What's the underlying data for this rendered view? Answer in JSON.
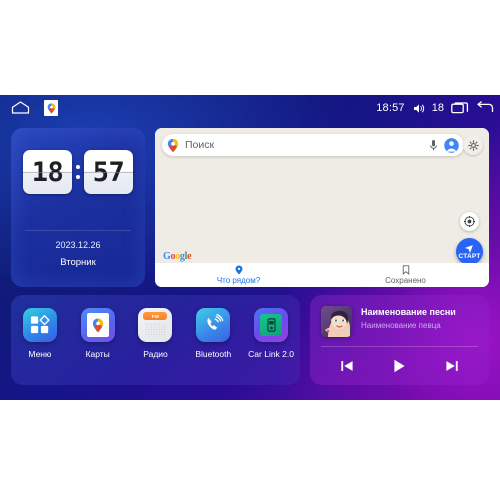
{
  "statusbar": {
    "home_icon": "home-icon",
    "notification_icon": "google-maps-notification-icon",
    "time": "18:57",
    "volume_icon": "volume-icon",
    "volume_level": "18",
    "recents_icon": "recents-icon",
    "back_icon": "back-icon"
  },
  "clock_widget": {
    "hours": "18",
    "minutes": "57",
    "date": "2023.12.26",
    "weekday": "Вторник"
  },
  "maps_widget": {
    "search": {
      "placeholder": "Поиск",
      "pin_icon": "google-maps-pin-icon",
      "mic_icon": "microphone-icon",
      "avatar_icon": "account-avatar-icon"
    },
    "settings_icon": "gear-icon",
    "locate_icon": "compass-locate-icon",
    "start_button": {
      "label": "СТАРТ",
      "icon": "navigation-arrow-icon"
    },
    "watermark": "Google",
    "tabs": [
      {
        "label": "Что рядом?",
        "icon": "map-pin-icon",
        "active": true
      },
      {
        "label": "Сохранено",
        "icon": "bookmark-icon",
        "active": false
      }
    ]
  },
  "apps": [
    {
      "label": "Меню",
      "icon": "menu-grid-icon"
    },
    {
      "label": "Карты",
      "icon": "google-maps-icon"
    },
    {
      "label": "Радио",
      "icon": "radio-icon",
      "band": "FM"
    },
    {
      "label": "Bluetooth",
      "icon": "bluetooth-phone-icon"
    },
    {
      "label": "Car Link 2.0",
      "icon": "car-link-icon"
    }
  ],
  "music": {
    "album_art": "album-art-portrait",
    "title": "Наименование песни",
    "artist": "Наименование певца",
    "controls": {
      "prev": "previous-track-icon",
      "play": "play-icon",
      "next": "next-track-icon"
    }
  },
  "colors": {
    "accent_blue": "#2a64f6",
    "tab_active": "#1a73e8",
    "map_bg": "#EFECE5",
    "artist_text": "#cfa8e8"
  }
}
